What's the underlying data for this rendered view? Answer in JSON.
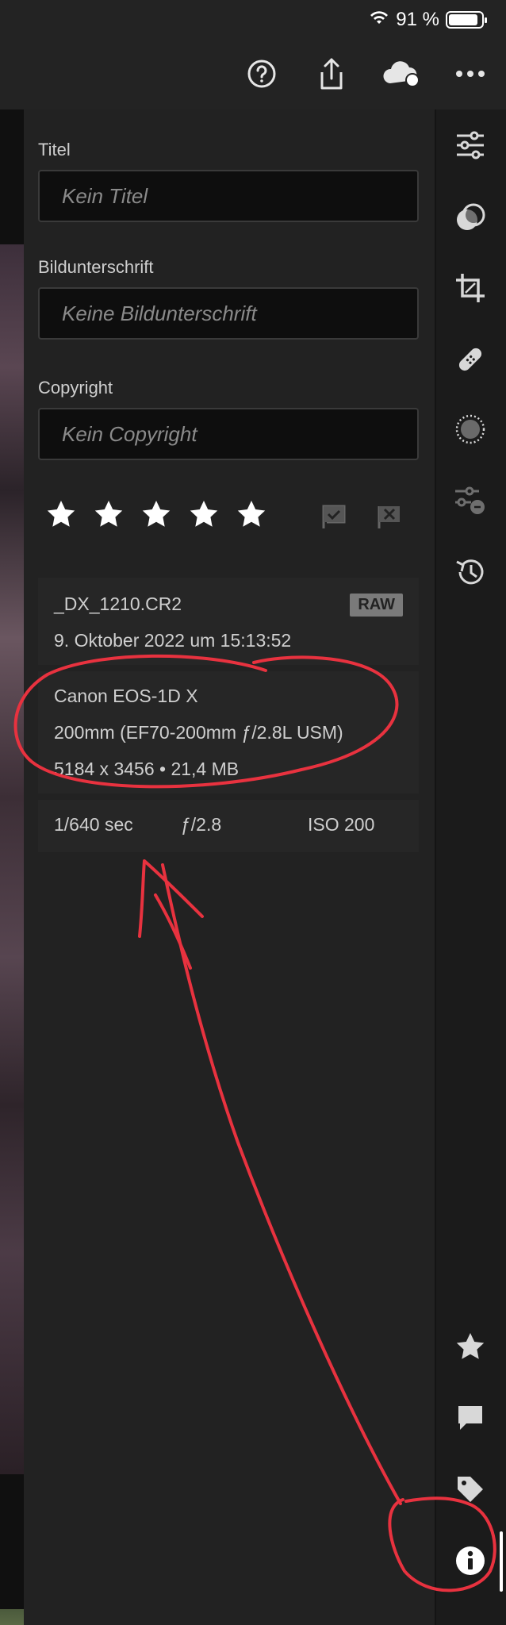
{
  "status_bar": {
    "battery": "91 %",
    "battery_level": 0.91
  },
  "toolbar": {
    "icons": [
      "help-icon",
      "share-icon",
      "cloud-sync-icon",
      "more-icon"
    ]
  },
  "metadata": {
    "title": {
      "label": "Titel",
      "placeholder": "Kein Titel"
    },
    "caption": {
      "label": "Bildunterschrift",
      "placeholder": "Keine Bildunterschrift"
    },
    "copyright": {
      "label": "Copyright",
      "placeholder": "Kein Copyright"
    }
  },
  "rating": {
    "stars": 5,
    "filled": 5
  },
  "info": {
    "filename": "_DX_1210.CR2",
    "badge": "RAW",
    "date": "9. Oktober 2022 um 15:13:52",
    "camera": "Canon EOS-1D X",
    "lens": "200mm (EF70-200mm ƒ/2.8L USM)",
    "size": "5184 x 3456 • 21,4 MB",
    "shutter": "1/640 sec",
    "aperture": "ƒ/2.8",
    "iso": "ISO 200"
  },
  "sidebar": {
    "top_icons": [
      "edit-sliders-icon",
      "masking-icon",
      "crop-icon",
      "healing-icon",
      "vignette-icon",
      "presets-icon",
      "history-icon"
    ],
    "bottom_icons": [
      "star-icon",
      "comment-icon",
      "tag-icon",
      "info-icon"
    ]
  },
  "colors": {
    "background": "#1d1d1d",
    "panel": "#222222",
    "annotation": "#e8323f"
  }
}
